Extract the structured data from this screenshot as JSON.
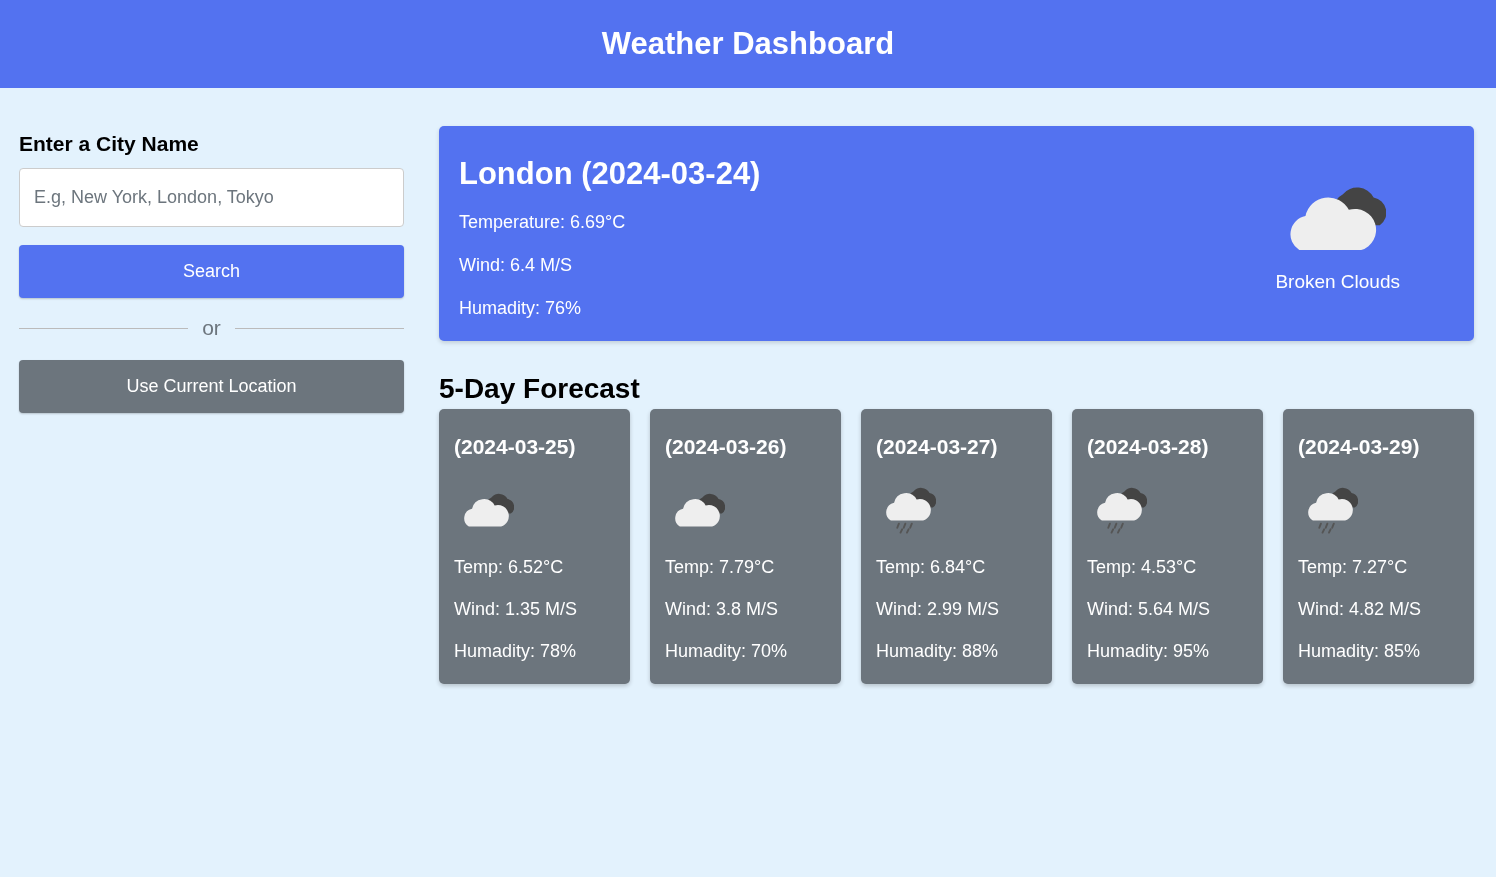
{
  "header": {
    "title": "Weather Dashboard"
  },
  "search": {
    "label": "Enter a City Name",
    "placeholder": "E.g, New York, London, Tokyo",
    "search_button": "Search",
    "divider": "or",
    "location_button": "Use Current Location"
  },
  "current": {
    "title": "London (2024-03-24)",
    "details": [
      "Temperature: 6.69°C",
      "Wind: 6.4 M/S",
      "Humadity: 76%"
    ],
    "icon": {
      "kind": "broken-clouds"
    },
    "description": "Broken Clouds"
  },
  "forecast": {
    "title": "5-Day Forecast",
    "days": [
      {
        "date": "(2024-03-25)",
        "icon": {
          "kind": "broken-clouds"
        },
        "details": [
          "Temp: 6.52°C",
          "Wind: 1.35 M/S",
          "Humadity: 78%"
        ]
      },
      {
        "date": "(2024-03-26)",
        "icon": {
          "kind": "broken-clouds"
        },
        "details": [
          "Temp: 7.79°C",
          "Wind: 3.8 M/S",
          "Humadity: 70%"
        ]
      },
      {
        "date": "(2024-03-27)",
        "icon": {
          "kind": "rain"
        },
        "details": [
          "Temp: 6.84°C",
          "Wind: 2.99 M/S",
          "Humadity: 88%"
        ]
      },
      {
        "date": "(2024-03-28)",
        "icon": {
          "kind": "rain"
        },
        "details": [
          "Temp: 4.53°C",
          "Wind: 5.64 M/S",
          "Humadity: 95%"
        ]
      },
      {
        "date": "(2024-03-29)",
        "icon": {
          "kind": "rain"
        },
        "details": [
          "Temp: 7.27°C",
          "Wind: 4.82 M/S",
          "Humadity: 85%"
        ]
      }
    ]
  }
}
